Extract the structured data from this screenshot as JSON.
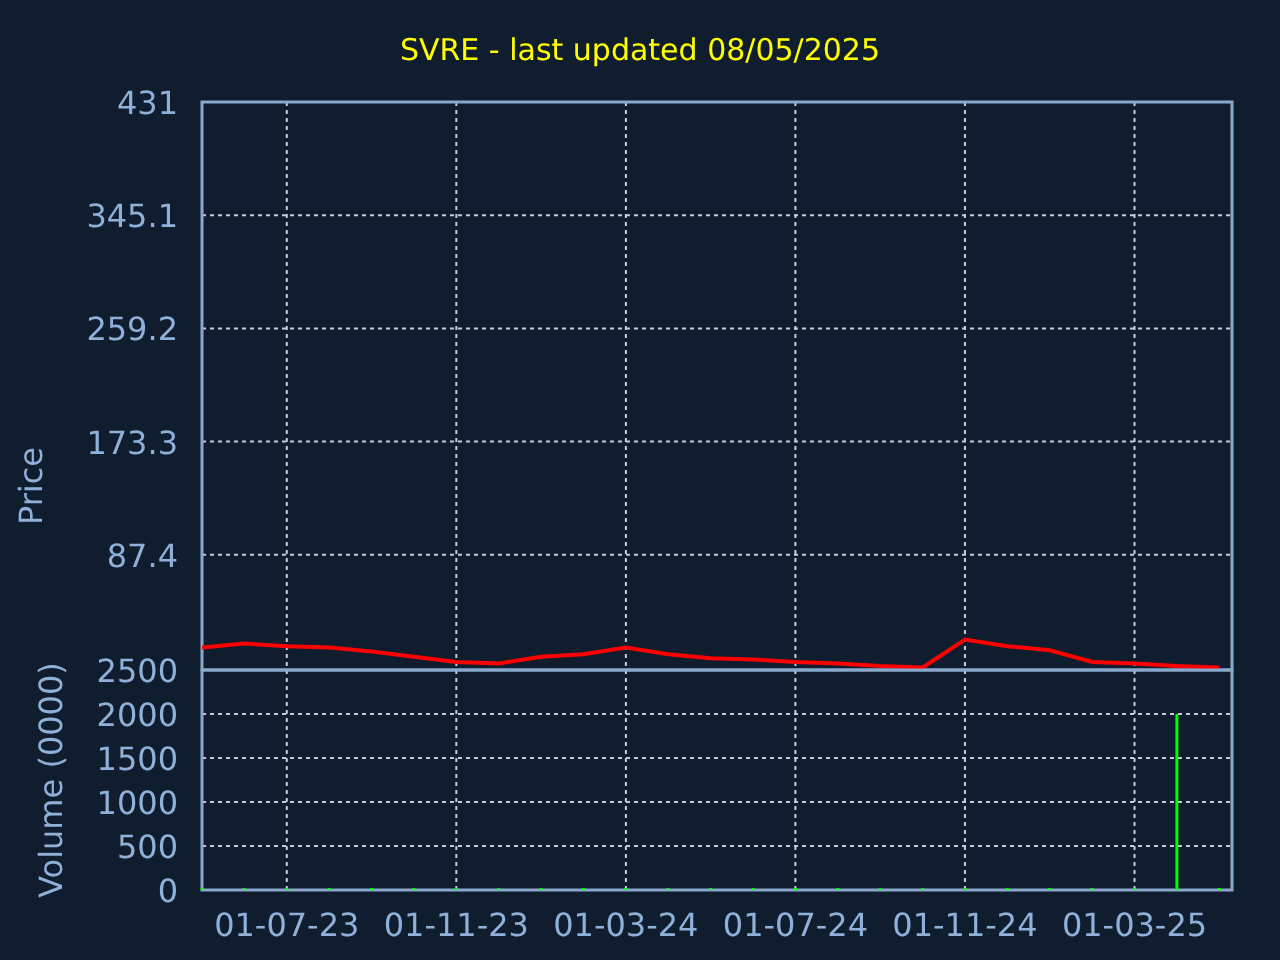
{
  "title": "SVRE - last updated 08/05/2025",
  "price_chart": {
    "chart_data": {
      "type": "line",
      "ylabel": "Price",
      "grid": true,
      "series": [
        {
          "color": "#ff0000",
          "values": [
            17,
            20,
            18,
            17,
            14,
            10,
            6,
            5,
            10,
            12,
            17,
            12,
            9,
            8,
            6,
            5,
            3,
            2,
            23,
            18,
            15,
            6,
            5,
            3,
            2
          ]
        }
      ],
      "ylim": [
        0,
        431
      ],
      "yticks": [
        87.4,
        173.3,
        259.2,
        345.1,
        431
      ]
    }
  },
  "volume_chart": {
    "chart_data": {
      "type": "bar",
      "ylabel": "Volume (0000)",
      "grid": true,
      "categories": [
        null,
        null,
        "01-07-23",
        null,
        null,
        null,
        "01-11-23",
        null,
        null,
        null,
        "01-03-24",
        null,
        null,
        null,
        "01-07-24",
        null,
        null,
        null,
        "01-11-24",
        null,
        null,
        null,
        "01-03-25",
        null,
        null
      ],
      "series": [
        {
          "color": "#00ff00",
          "values": [
            0,
            0,
            0,
            0,
            0,
            0,
            0,
            0,
            0,
            0,
            0,
            0,
            0,
            0,
            0,
            0,
            0,
            0,
            0,
            0,
            0,
            0,
            0,
            2000,
            0
          ]
        }
      ],
      "ylim": [
        0,
        2500
      ],
      "yticks": [
        0,
        500,
        1000,
        1500,
        2000,
        2500
      ]
    }
  }
}
